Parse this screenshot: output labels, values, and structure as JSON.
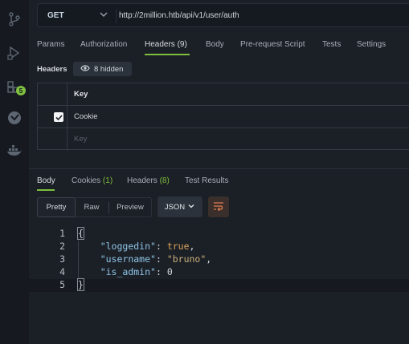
{
  "request": {
    "method": "GET",
    "url": "http://2million.htb/api/v1/user/auth",
    "tabs": [
      {
        "label": "Params"
      },
      {
        "label": "Authorization"
      },
      {
        "label": "Headers (9)"
      },
      {
        "label": "Body"
      },
      {
        "label": "Pre-request Script"
      },
      {
        "label": "Tests"
      },
      {
        "label": "Settings"
      }
    ],
    "active_tab": "Headers (9)"
  },
  "headers_section": {
    "label": "Headers",
    "hidden_button": "8 hidden",
    "table": {
      "column_header": "Key",
      "rows": [
        {
          "key": "Cookie",
          "checked": true
        }
      ],
      "placeholder": "Key"
    }
  },
  "sidebar": {
    "icons": [
      "branch-icon",
      "runner-icon",
      "extensions-icon",
      "clock-icon",
      "docker-icon"
    ],
    "badge": "5"
  },
  "response": {
    "tabs": [
      {
        "label": "Body",
        "count": ""
      },
      {
        "label": "Cookies",
        "count": "(1)"
      },
      {
        "label": "Headers",
        "count": "(8)"
      },
      {
        "label": "Test Results",
        "count": ""
      }
    ],
    "active_tab": "Body",
    "view_modes": [
      "Pretty",
      "Raw",
      "Preview"
    ],
    "active_view": "Pretty",
    "format": "JSON",
    "body_lines": [
      {
        "num": "1",
        "open": "{"
      },
      {
        "num": "2",
        "key": "\"loggedin\"",
        "value": "true"
      },
      {
        "num": "3",
        "key": "\"username\"",
        "value": "\"bruno\""
      },
      {
        "num": "4",
        "key": "\"is_admin\"",
        "value": "0"
      },
      {
        "num": "5",
        "close": "}"
      }
    ]
  },
  "colors": {
    "accent": "#7fbf3f",
    "background": "#1b1f26",
    "sidebar": "#161a20"
  }
}
